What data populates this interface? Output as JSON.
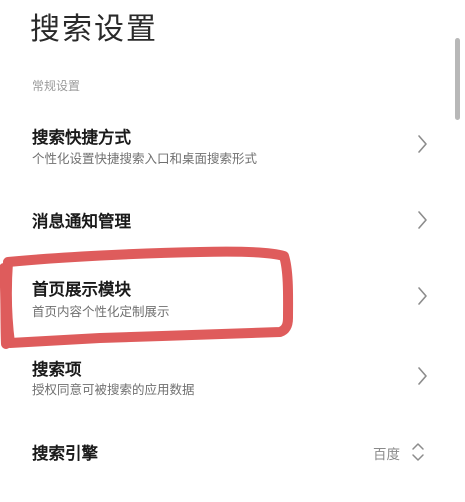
{
  "header": {
    "title": "搜索设置"
  },
  "section": {
    "label": "常规设置"
  },
  "items": [
    {
      "title": "搜索快捷方式",
      "subtitle": "个性化设置快捷搜索入口和桌面搜索形式"
    },
    {
      "title": "消息通知管理"
    },
    {
      "title": "首页展示模块",
      "subtitle": "首页内容个性化定制展示"
    },
    {
      "title": "搜索项",
      "subtitle": "授权同意可被搜索的应用数据"
    },
    {
      "title": "搜索引擎",
      "value": "百度"
    }
  ],
  "icons": {
    "chevron": "chevron-right-icon",
    "selector": "chevron-up-down-icon"
  },
  "colors": {
    "highlight": "#d94040",
    "chevron": "#8c8c8c",
    "scrollbar": "#b8b8b8"
  }
}
